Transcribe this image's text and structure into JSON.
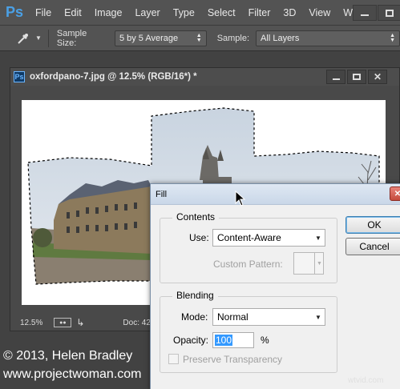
{
  "menubar": {
    "logo": "Ps",
    "items": [
      "File",
      "Edit",
      "Image",
      "Layer",
      "Type",
      "Select",
      "Filter",
      "3D",
      "View",
      "W"
    ]
  },
  "options_bar": {
    "sample_size_label": "Sample Size:",
    "sample_size_value": "5 by 5 Average",
    "sample_label": "Sample:",
    "sample_value": "All Layers"
  },
  "document": {
    "title": "oxfordpano-7.jpg @ 12.5% (RGB/16*) *",
    "zoom": "12.5%",
    "doc_info": "Doc: 42."
  },
  "fill_dialog": {
    "title": "Fill",
    "close_label": "✕",
    "contents_legend": "Contents",
    "use_label": "Use:",
    "use_value": "Content-Aware",
    "custom_pattern_label": "Custom Pattern:",
    "blending_legend": "Blending",
    "mode_label": "Mode:",
    "mode_value": "Normal",
    "opacity_label": "Opacity:",
    "opacity_value": "100",
    "opacity_unit": "%",
    "preserve_label": "Preserve Transparency",
    "ok_label": "OK",
    "cancel_label": "Cancel"
  },
  "watermark": {
    "copyright": "© 2013, Helen Bradley",
    "website": "www.projectwoman.com",
    "badge": "wtvid.com"
  },
  "colors": {
    "ps_blue": "#4aa0e6",
    "ui_dark": "#535353",
    "selection_text": "#3399ff"
  }
}
